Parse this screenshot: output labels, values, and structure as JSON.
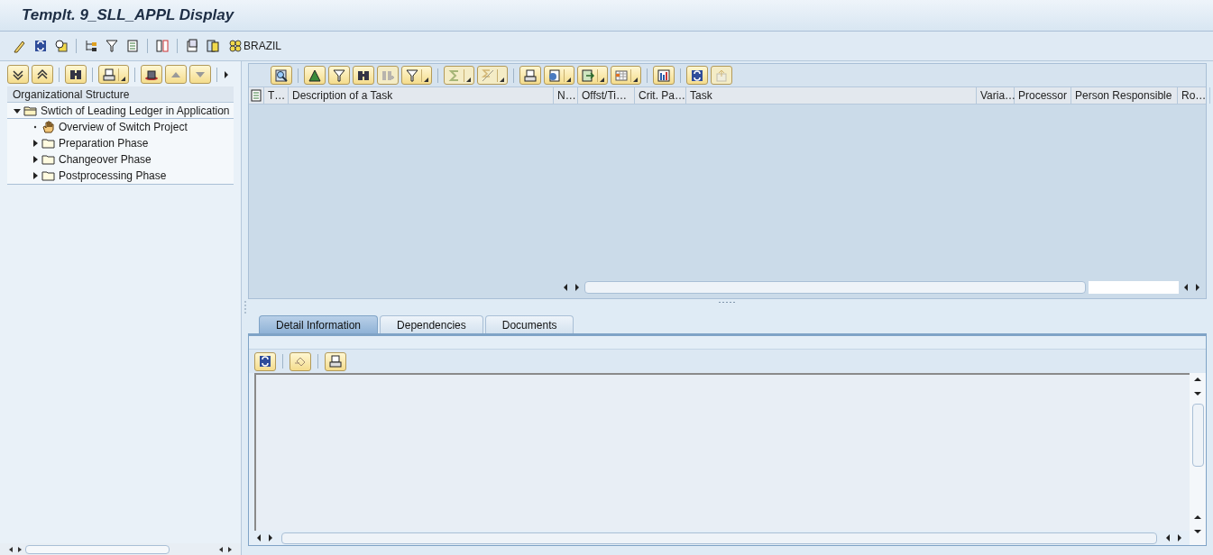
{
  "window": {
    "title": "Templt. 9_SLL_APPL Display"
  },
  "toolbar": {
    "label": "BRAZIL"
  },
  "tree": {
    "header": "Organizational Structure",
    "nodes": [
      {
        "label": "Swtich of Leading Ledger in Application",
        "kind": "folder",
        "expanded": true,
        "children": [
          {
            "label": "Overview of Switch Project",
            "kind": "leaf"
          },
          {
            "label": "Preparation Phase",
            "kind": "folder",
            "expanded": false
          },
          {
            "label": "Changeover Phase",
            "kind": "folder",
            "expanded": false
          },
          {
            "label": "Postprocessing Phase",
            "kind": "folder",
            "expanded": false
          }
        ]
      }
    ]
  },
  "grid_toolbar": [
    {
      "menu": false,
      "disabled": false
    },
    {
      "menu": false,
      "disabled": false
    },
    {
      "menu": false,
      "disabled": false
    },
    {
      "menu": false,
      "disabled": false
    },
    {
      "menu": false,
      "disabled": true
    },
    {
      "menu": true,
      "disabled": false
    },
    {
      "menu": true,
      "disabled": true
    },
    {
      "menu": true,
      "disabled": true
    },
    {
      "menu": false,
      "disabled": false
    },
    {
      "menu": true,
      "disabled": false
    },
    {
      "menu": true,
      "disabled": false
    },
    {
      "menu": true,
      "disabled": false
    },
    {
      "menu": false,
      "disabled": false
    },
    {
      "menu": false,
      "disabled": false
    },
    {
      "menu": false,
      "disabled": true
    }
  ],
  "table": {
    "columns": [
      "T…",
      "Description of a Task",
      "N…",
      "Offst/Ti…",
      "Crit. Pa…",
      "Task",
      "Varia…",
      "Processor",
      "Person Responsible",
      "Ro…"
    ]
  },
  "tabs": [
    {
      "label": "Detail Information",
      "selected": true
    },
    {
      "label": "Dependencies",
      "selected": false
    },
    {
      "label": "Documents",
      "selected": false
    }
  ]
}
